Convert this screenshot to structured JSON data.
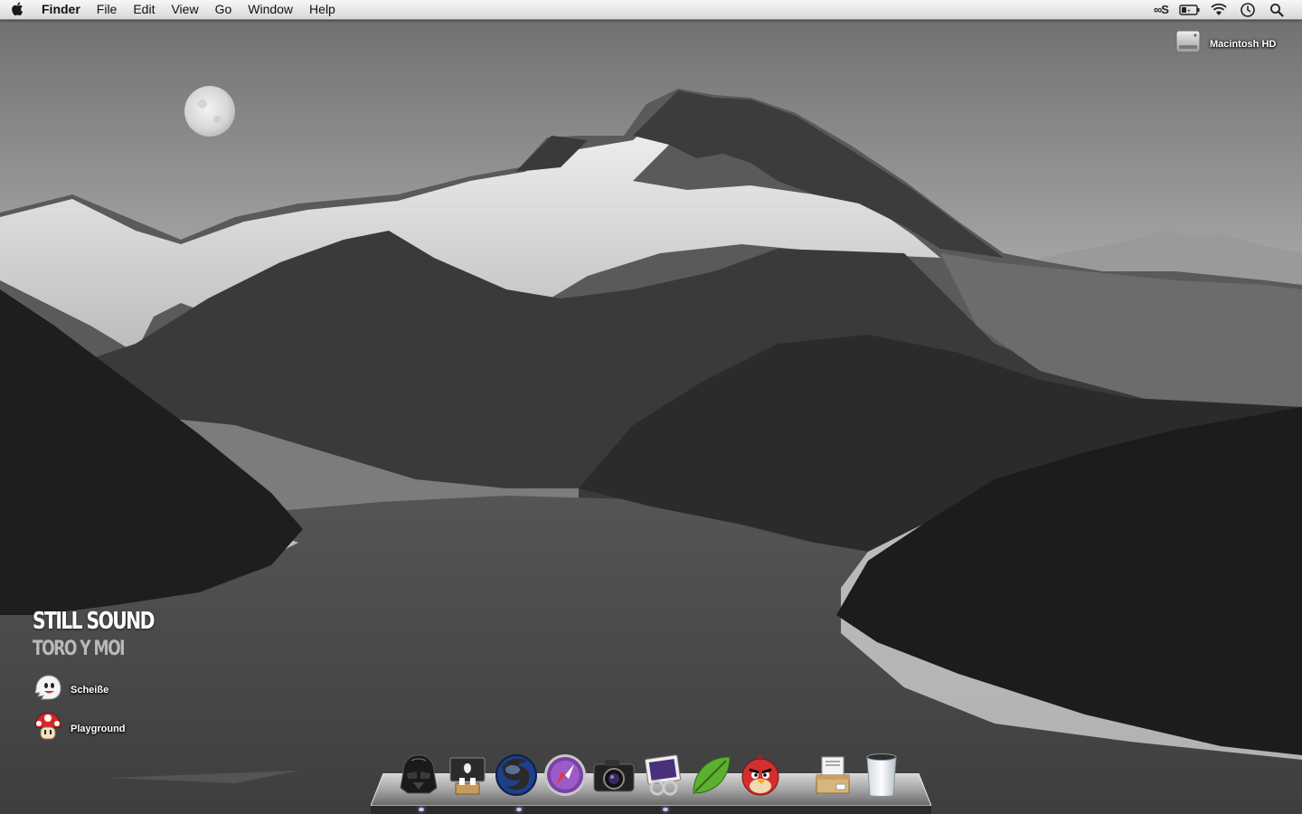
{
  "menubar": {
    "apple_icon": "apple-logo-icon",
    "app_name": "Finder",
    "items": [
      "File",
      "Edit",
      "View",
      "Go",
      "Window",
      "Help"
    ],
    "status": {
      "lastfm": "∞S",
      "icons": [
        "lastfm-scrobbler-icon",
        "battery-charging-icon",
        "wifi-icon",
        "time-machine-icon",
        "spotlight-search-icon"
      ]
    }
  },
  "desktop": {
    "volume": {
      "label": "Macintosh HD",
      "icon": "hard-drive-icon"
    },
    "now_playing": {
      "song": "STILL SOUND",
      "artist": "TORO Y MOI"
    },
    "items": [
      {
        "label": "Scheiße",
        "icon": "boo-ghost-folder-icon"
      },
      {
        "label": "Playground",
        "icon": "mushroom-folder-icon"
      }
    ]
  },
  "dock": {
    "apps": [
      {
        "icon": "darth-vader-finder-icon",
        "running": true
      },
      {
        "icon": "app-store-icon",
        "running": false
      },
      {
        "icon": "firefox-icon",
        "running": true
      },
      {
        "icon": "safari-icon",
        "running": false
      },
      {
        "icon": "camera-iphoto-icon",
        "running": false
      },
      {
        "icon": "preview-icon",
        "running": true
      },
      {
        "icon": "leaf-rss-icon",
        "running": false
      },
      {
        "icon": "angry-birds-icon",
        "running": false
      }
    ],
    "others": [
      {
        "icon": "documents-stack-icon"
      },
      {
        "icon": "trash-icon"
      }
    ]
  },
  "colors": {
    "menubar": "#e6e6e6",
    "dock_indicator": "#d7c2ff",
    "sky": "#bdbdbd"
  }
}
